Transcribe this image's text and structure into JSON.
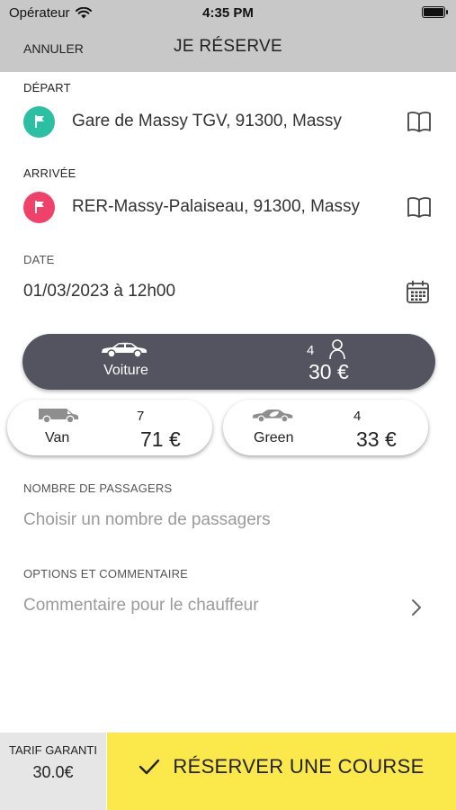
{
  "status_bar": {
    "carrier": "Opérateur",
    "time": "4:35 PM"
  },
  "nav": {
    "cancel": "ANNULER",
    "title": "JE RÉSERVE"
  },
  "departure": {
    "label": "DÉPART",
    "address": "Gare de Massy TGV, 91300, Massy",
    "pin_color": "#2bbfa3"
  },
  "arrival": {
    "label": "ARRIVÉE",
    "address": "RER-Massy-Palaiseau, 91300, Massy",
    "pin_color": "#f0416a"
  },
  "date": {
    "label": "DATE",
    "value": "01/03/2023 à 12h00"
  },
  "vehicles": {
    "selected": {
      "name": "Voiture",
      "seats": "4",
      "price": "30 €"
    },
    "options": [
      {
        "name": "Van",
        "seats": "7",
        "price": "71 €"
      },
      {
        "name": "Green",
        "seats": "4",
        "price": "33 €"
      }
    ]
  },
  "passengers": {
    "label": "NOMBRE DE PASSAGERS",
    "placeholder": "Choisir un nombre de passagers"
  },
  "options": {
    "label": "OPTIONS ET COMMENTAIRE",
    "placeholder": "Commentaire pour le chauffeur"
  },
  "footer": {
    "tarif_label": "TARIF GARANTI",
    "tarif_value": "30.0€",
    "reserve_label": "RÉSERVER UNE COURSE"
  },
  "colors": {
    "accent": "#fbe84a",
    "selected_vehicle": "#545461",
    "header": "#c8c8c8"
  }
}
